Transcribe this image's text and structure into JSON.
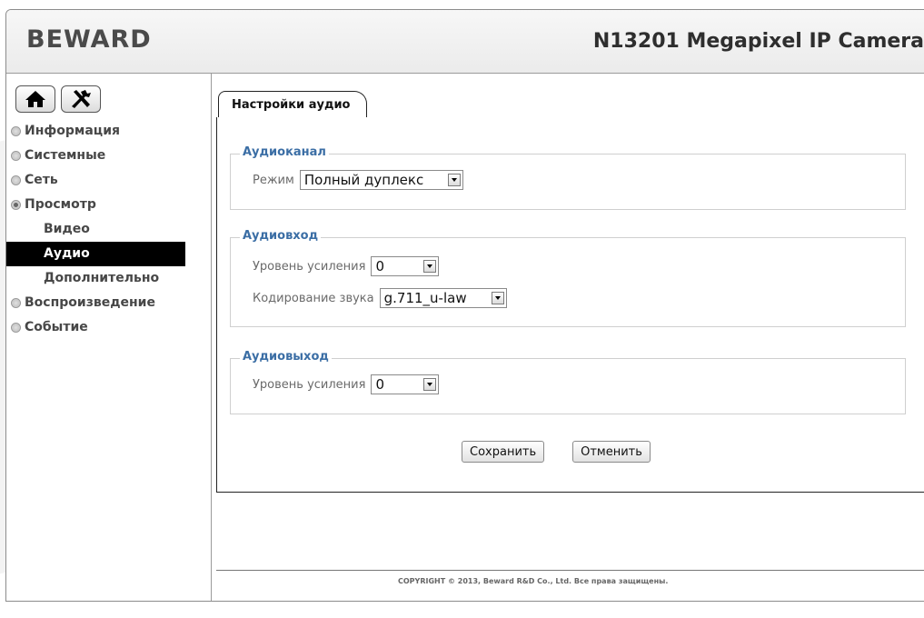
{
  "header": {
    "logo": "BEWARD",
    "model_title": "N13201 Megapixel IP Camera"
  },
  "sidebar": {
    "home_icon": "home-icon",
    "settings_icon": "tools-icon",
    "items": [
      {
        "label": "Информация"
      },
      {
        "label": "Системные"
      },
      {
        "label": "Сеть"
      },
      {
        "label": "Просмотр"
      }
    ],
    "sub_items": [
      {
        "label": "Видео"
      },
      {
        "label": "Аудио"
      },
      {
        "label": "Дополнительно"
      }
    ],
    "items_after": [
      {
        "label": "Воспроизведение"
      },
      {
        "label": "Событие"
      }
    ]
  },
  "main": {
    "tab_label": "Настройки аудио",
    "channel": {
      "legend": "Аудиоканал",
      "mode_label": "Режим",
      "mode_value": "Полный дуплекс"
    },
    "input": {
      "legend": "Аудиовход",
      "gain_label": "Уровень усиления",
      "gain_value": "0",
      "codec_label": "Кодирование звука",
      "codec_value": "g.711_u-law"
    },
    "output": {
      "legend": "Аудиовыход",
      "gain_label": "Уровень усиления",
      "gain_value": "0"
    },
    "save_label": "Сохранить",
    "cancel_label": "Отменить"
  },
  "footer": {
    "copyright": "COPYRIGHT © 2013, Beward R&D Co., Ltd. Все права защищены."
  },
  "colors": {
    "legend": "#3b6ea5",
    "active_bg": "#000000",
    "watermark": "#f2f2f2"
  }
}
